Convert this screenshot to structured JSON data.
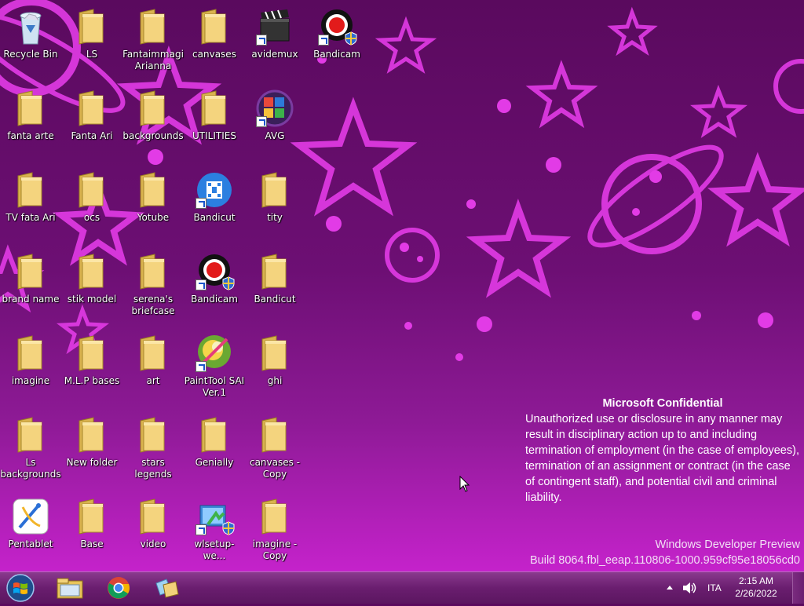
{
  "desktop": {
    "columns": [
      [
        "Recycle Bin",
        "fanta arte",
        "TV  fata Ari",
        "brand name",
        "imagine",
        "Ls backgrounds",
        "Pentablet"
      ],
      [
        "LS",
        "Fanta Ari",
        "ocs",
        "stik  model",
        "M.L.P bases",
        "New folder",
        "Base"
      ],
      [
        "Fantaimmagi Arianna",
        "backgrounds",
        "Yotube",
        "serena's briefcase",
        "art",
        "stars legends",
        "video"
      ],
      [
        "canvases",
        "UTILITIES",
        "Bandicut",
        "Bandicam",
        "PaintTool SAI Ver.1",
        "Genially",
        "wlsetup-we..."
      ],
      [
        "avidemux",
        "AVG",
        "tity",
        "Bandicut",
        "ghi",
        "canvases - Copy",
        "imagine - Copy"
      ],
      [
        "Bandicam"
      ]
    ]
  },
  "notice": {
    "title": "Microsoft Confidential",
    "body": "Unauthorized use or disclosure in any manner may result in disciplinary action up to and including termination of employment (in the case of employees), termination of an assignment or contract (in the case of contingent staff), and potential civil and criminal liability."
  },
  "watermark": {
    "line1": "Windows Developer Preview",
    "line2": "Build 8064.fbl_eeap.110806-1000.959cf95e18056cd0"
  },
  "taskbar": {
    "language": "ITA",
    "time": "2:15 AM",
    "date": "2/26/2022"
  },
  "colors": {
    "wallpaper_top": "#5a0a5e",
    "wallpaper_bottom": "#d024d6",
    "decoration": "#e23be6",
    "folder": "#f2d27a"
  }
}
